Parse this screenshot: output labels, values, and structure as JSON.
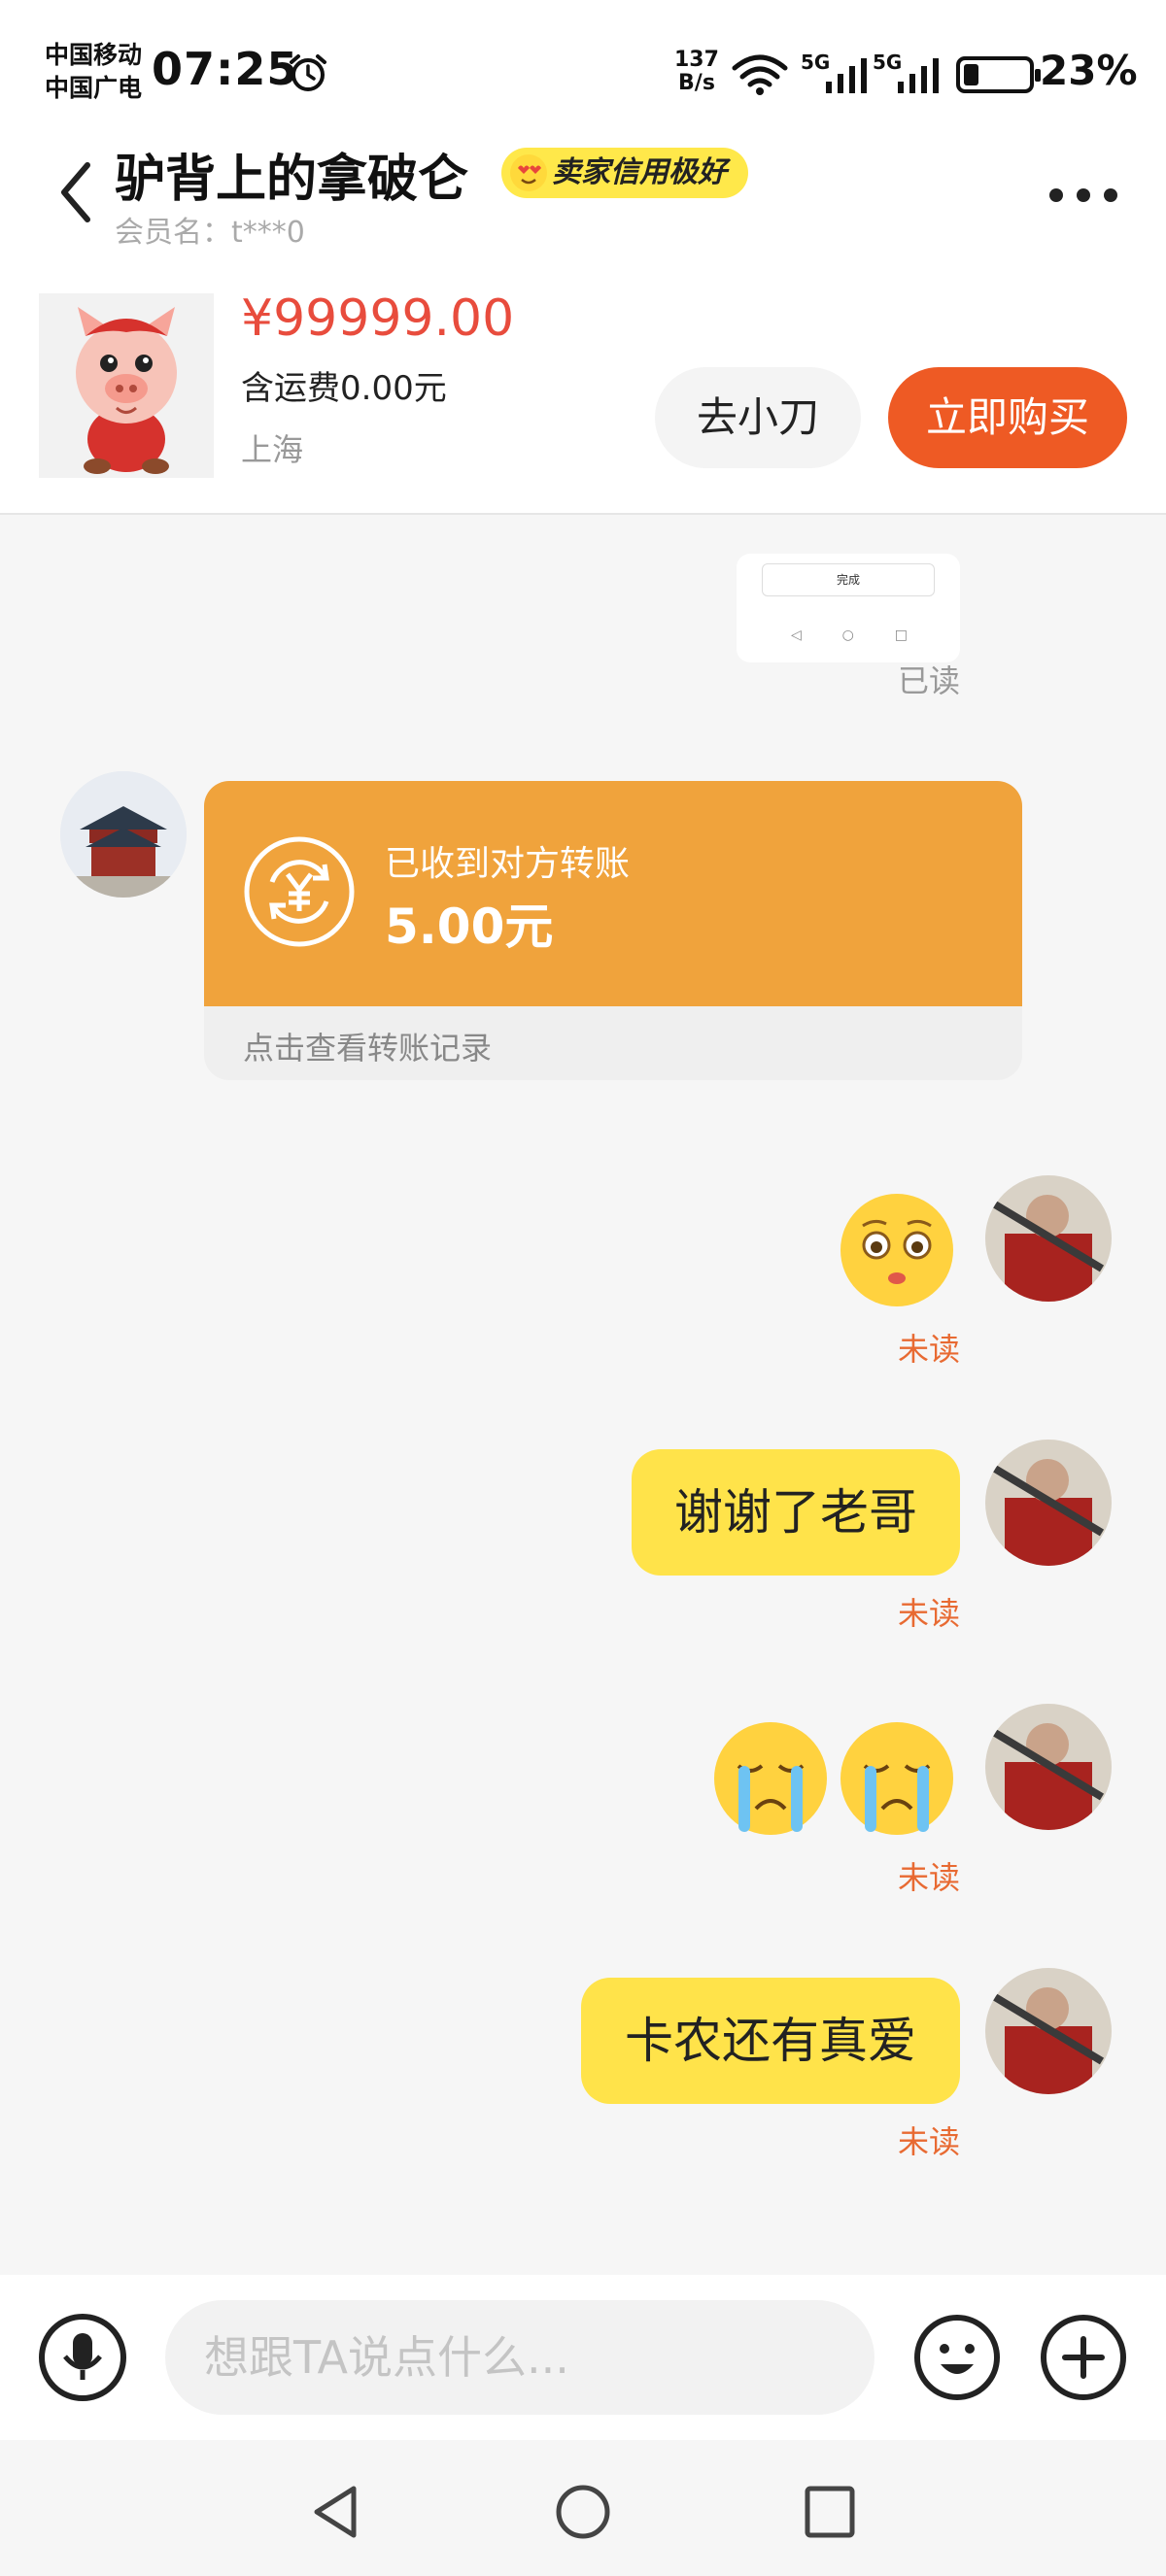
{
  "status_bar": {
    "carrier_1": "中国移动",
    "carrier_2": "中国广电",
    "time": "07:25",
    "net_speed_value": "137",
    "net_speed_unit": "B/s",
    "signal_1_label": "5G",
    "signal_2_label": "5G",
    "battery_level": 0.23,
    "battery_percent": "23%"
  },
  "header": {
    "title": "驴背上的拿破仑",
    "badge": "卖家信用极好",
    "member": "会员名：t***0"
  },
  "product": {
    "price": "¥99999.00",
    "shipping": "含运费0.00元",
    "location": "上海",
    "bargain_button": "去小刀",
    "buy_button": "立即购买"
  },
  "chat": {
    "screenshot_done": "完成",
    "read_label": "已读",
    "transfer": {
      "title": "已收到对方转账",
      "amount": "5.00元",
      "link": "点击查看转账记录"
    },
    "messages": [
      {
        "text": "谢谢了老哥"
      },
      {
        "text": "卡农还有真爱"
      }
    ],
    "unread_label": "未读"
  },
  "input": {
    "placeholder": "想跟TA说点什么..."
  },
  "colors": {
    "accent_orange": "#ee5a24",
    "bubble_yellow": "#ffe34a",
    "transfer_orange": "#f0a33c",
    "price_red": "#e84c3d"
  }
}
